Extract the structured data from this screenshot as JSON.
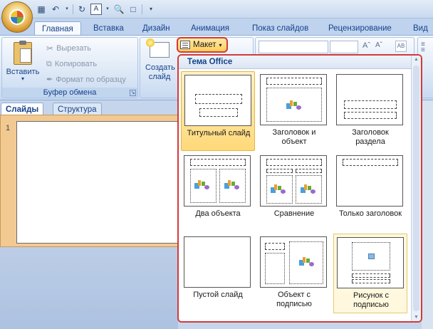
{
  "qat": {
    "save_icon": "save-icon",
    "undo_icon": "undo-icon",
    "redo_icon": "redo-icon",
    "font_icon": "font-color-icon",
    "print_icon": "print-preview-icon",
    "new_icon": "new-document-icon",
    "customize_icon": "customize-qat-icon"
  },
  "tabs": {
    "home": "Главная",
    "insert": "Вставка",
    "design": "Дизайн",
    "animation": "Анимация",
    "slideshow": "Показ слайдов",
    "review": "Рецензирование",
    "view": "Вид"
  },
  "clipboard": {
    "paste": "Вставить",
    "cut": "Вырезать",
    "copy": "Копировать",
    "format_painter": "Формат по образцу",
    "group_label": "Буфер обмена"
  },
  "slides_group": {
    "new_slide": "Создать слайд",
    "layout": "Макет"
  },
  "left_panel": {
    "tab_slides": "Слайды",
    "tab_outline": "Структура",
    "slide_number": "1"
  },
  "gallery": {
    "header": "Тема Office",
    "layouts": [
      {
        "label": "Титульный слайд"
      },
      {
        "label": "Заголовок и объект"
      },
      {
        "label": "Заголовок раздела"
      },
      {
        "label": "Два объекта"
      },
      {
        "label": "Сравнение"
      },
      {
        "label": "Только заголовок"
      },
      {
        "label": "Пустой слайд"
      },
      {
        "label": "Объект с подписью"
      },
      {
        "label": "Рисунок с подписью"
      }
    ]
  }
}
